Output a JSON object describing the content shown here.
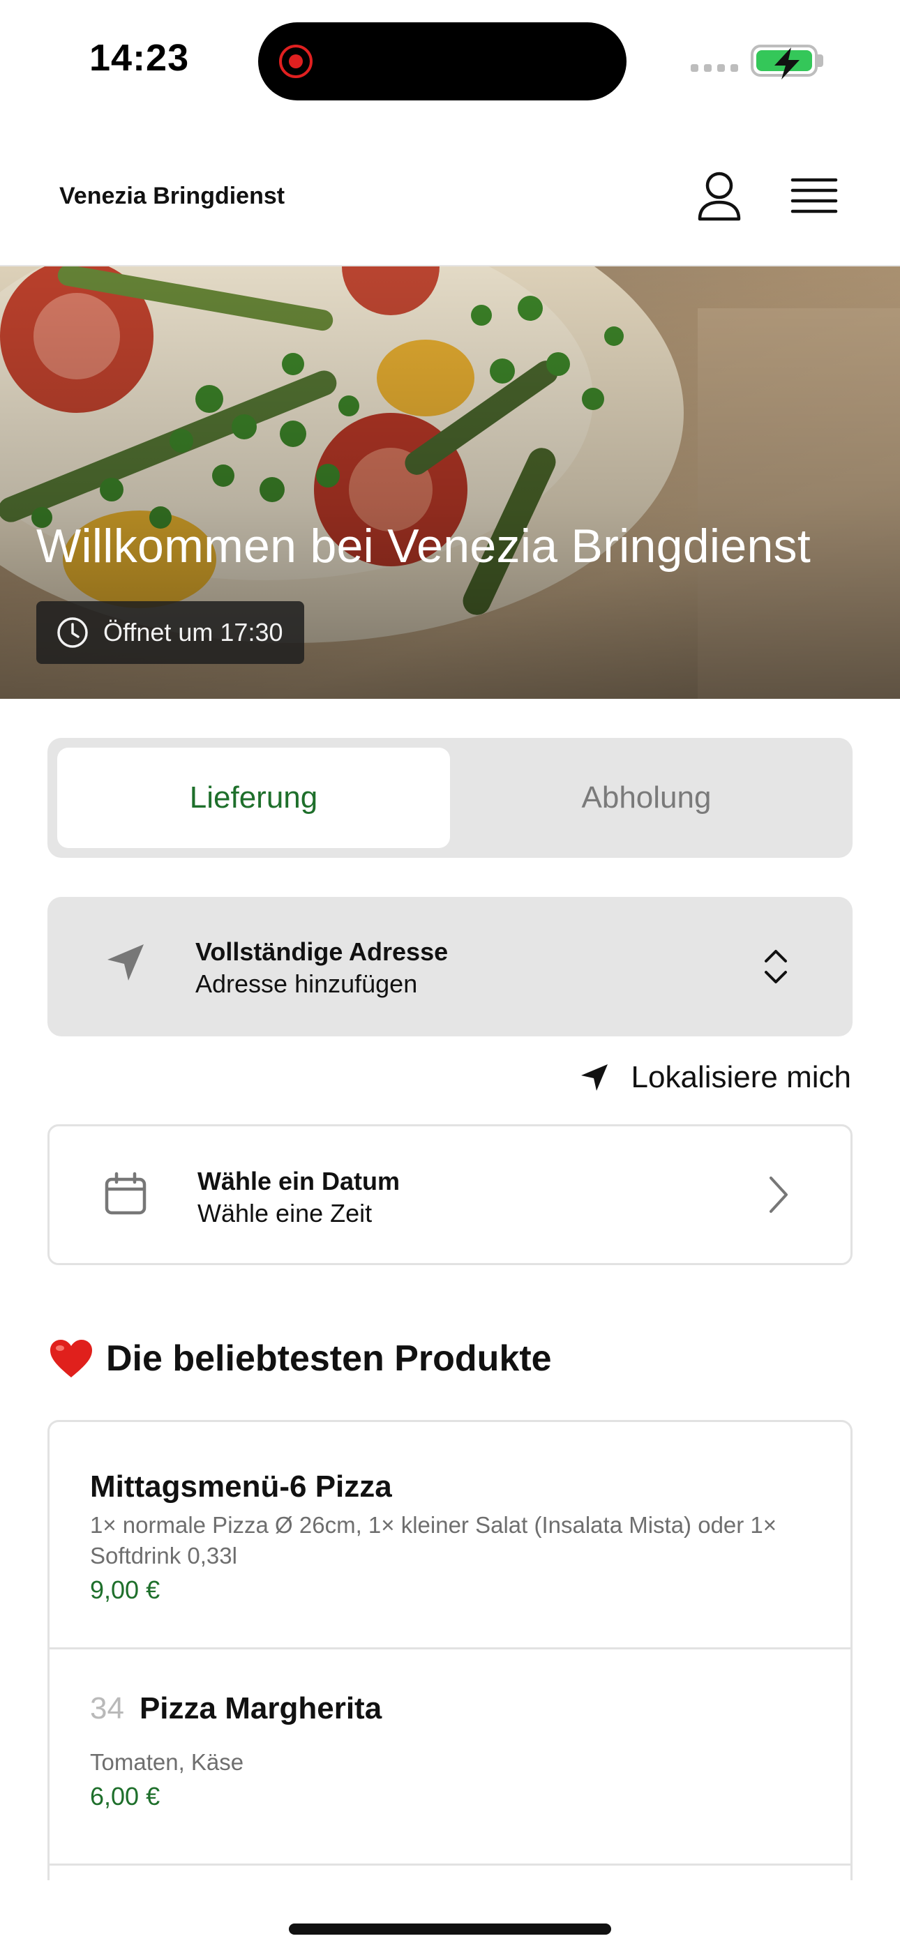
{
  "status_bar": {
    "time": "14:23"
  },
  "header": {
    "brand": "Venezia Bringdienst"
  },
  "hero": {
    "title": "Willkommen bei Venezia Bringdienst",
    "opening_text": "Öffnet um 17:30"
  },
  "mode_toggle": {
    "delivery": "Lieferung",
    "pickup": "Abholung",
    "selected": "Lieferung"
  },
  "address": {
    "title": "Vollständige Adresse",
    "subtitle": "Adresse hinzufügen"
  },
  "locate": {
    "label": "Lokalisiere mich"
  },
  "date": {
    "title": "Wähle ein Datum",
    "subtitle": "Wähle eine Zeit"
  },
  "popular": {
    "title": "Die beliebtesten Produkte",
    "products": [
      {
        "number": "",
        "name": "Mittagsmenü-6 Pizza",
        "description": "1× normale Pizza Ø 26cm, 1× kleiner Salat (Insalata Mista) oder 1× Softdrink 0,33l",
        "price": "9,00 €"
      },
      {
        "number": "34",
        "name": "Pizza Margherita",
        "description": "Tomaten, Käse",
        "price": "6,00 €"
      }
    ]
  },
  "colors": {
    "accent_green": "#1e6f2b",
    "battery_green": "#34c759",
    "recording_red": "#e02020"
  },
  "icons": [
    "user-icon",
    "menu-icon",
    "clock-icon",
    "navigation-arrow-icon",
    "chevron-up-down-icon",
    "calendar-icon",
    "chevron-right-icon",
    "heart-icon"
  ]
}
